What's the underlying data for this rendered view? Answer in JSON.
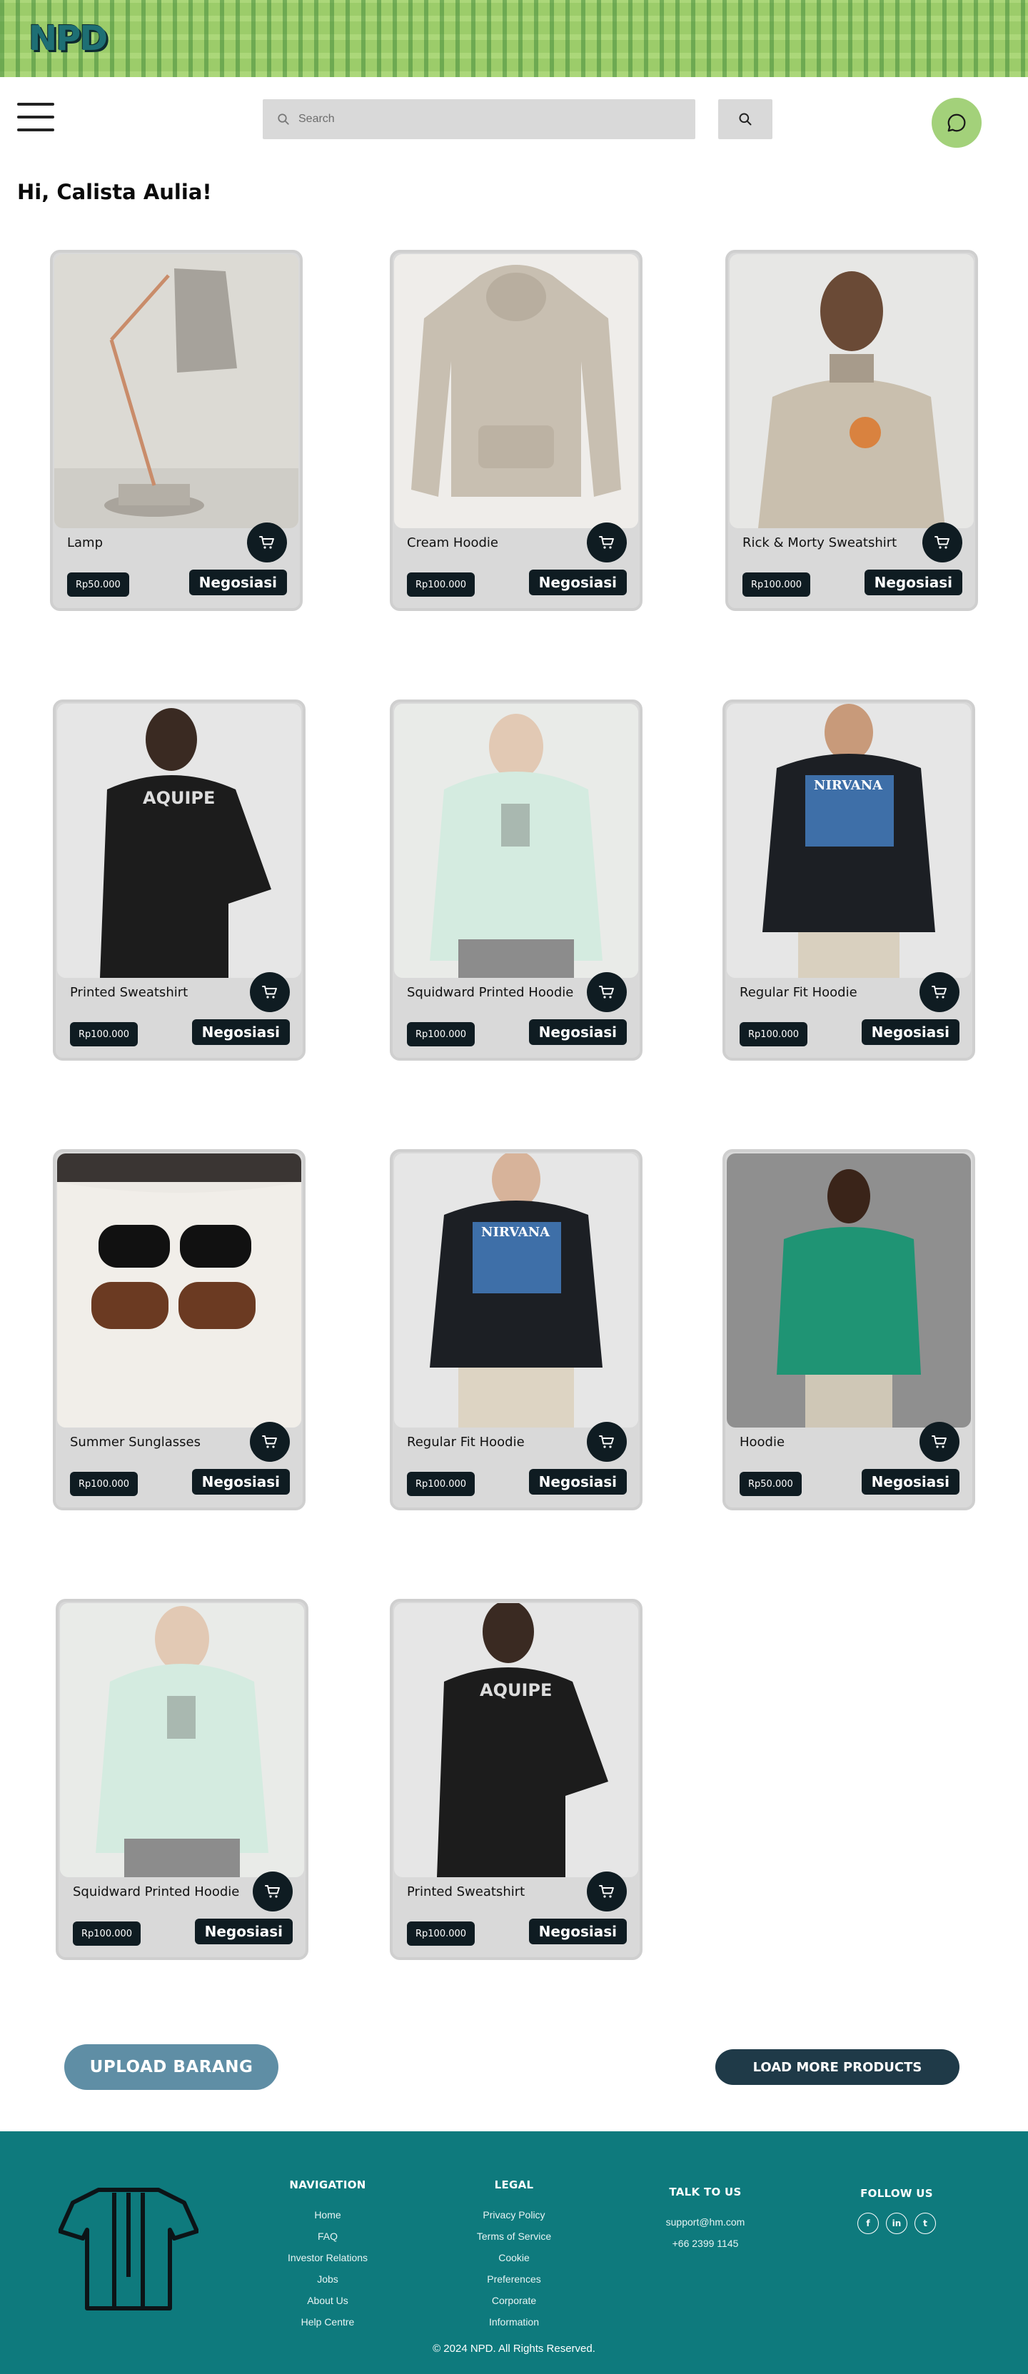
{
  "header": {
    "logo_text": "NPD",
    "search_placeholder": "Search",
    "search_icon": "search-icon",
    "chat_icon": "chat-bubble-icon",
    "menu_icon": "hamburger-menu-icon"
  },
  "greeting": "Hi, Calista Aulia!",
  "products": [
    {
      "name": "Lamp",
      "price": "Rp50.000",
      "action": "Negosiasi"
    },
    {
      "name": "Cream Hoodie",
      "price": "Rp100.000",
      "action": "Negosiasi"
    },
    {
      "name": "Rick & Morty Sweatshirt",
      "price": "Rp100.000",
      "action": "Negosiasi"
    },
    {
      "name": "Printed Sweatshirt",
      "price": "Rp100.000",
      "action": "Negosiasi"
    },
    {
      "name": "Squidward Printed Hoodie",
      "price": "Rp100.000",
      "action": "Negosiasi"
    },
    {
      "name": "Regular Fit Hoodie",
      "price": "Rp100.000",
      "action": "Negosiasi"
    },
    {
      "name": "Summer Sunglasses",
      "price": "Rp100.000",
      "action": "Negosiasi"
    },
    {
      "name": "Regular Fit Hoodie",
      "price": "Rp100.000",
      "action": "Negosiasi"
    },
    {
      "name": "Hoodie",
      "price": "Rp50.000",
      "action": "Negosiasi"
    },
    {
      "name": "Squidward Printed Hoodie",
      "price": "Rp100.000",
      "action": "Negosiasi"
    },
    {
      "name": "Printed Sweatshirt",
      "price": "Rp100.000",
      "action": "Negosiasi"
    }
  ],
  "actions": {
    "upload_label": "UPLOAD BARANG",
    "load_more_label": "LOAD MORE PRODUCTS"
  },
  "footer": {
    "navigation": {
      "title": "NAVIGATION",
      "links": [
        "Home",
        "FAQ",
        "Investor Relations",
        "Jobs",
        "About Us",
        "Help Centre"
      ]
    },
    "legal": {
      "title": "LEGAL",
      "links": [
        "Privacy Policy",
        "Terms of Service",
        "Cookie",
        "Preferences",
        "Corporate",
        "Information"
      ]
    },
    "talk": {
      "title": "TALK TO US",
      "email": "support@hm.com",
      "phone": "+66 2399 1145"
    },
    "follow": {
      "title": "FOLLOW US",
      "icons": [
        "facebook-icon",
        "linkedin-icon",
        "twitter-icon"
      ],
      "glyphs": [
        "f",
        "in",
        "t"
      ]
    },
    "copyright": "© 2024 NPD. All Rights Reserved."
  },
  "colors": {
    "banner": "#9ccc6a",
    "chat_button": "#a3d17a",
    "dark": "#0f1c22",
    "upload_button": "#5f8ea5",
    "load_more_button": "#1f3a48",
    "footer": "#0e7a7d"
  }
}
